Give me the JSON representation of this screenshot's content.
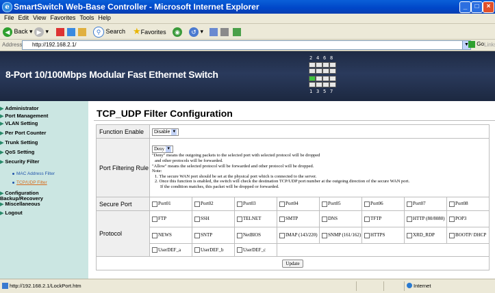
{
  "window": {
    "title": "SmartSwitch Web-Base Controller - Microsoft Internet Explorer"
  },
  "menu": [
    "File",
    "Edit",
    "View",
    "Favorites",
    "Tools",
    "Help"
  ],
  "toolbar": {
    "back": "Back",
    "search": "Search",
    "favorites": "Favorites"
  },
  "address": {
    "label": "Address",
    "url": "http://192.168.2.1/",
    "go": "Go",
    "links": "Links"
  },
  "banner": {
    "title": "8-Port 10/100Mbps Modular Fast Ethernet Switch",
    "ports_top": [
      "2",
      "4",
      "6",
      "8"
    ],
    "ports_bottom": [
      "1",
      "3",
      "5",
      "7"
    ]
  },
  "sidebar": {
    "items": [
      {
        "label": "Administrator"
      },
      {
        "label": "Port Management"
      },
      {
        "label": "VLAN Setting"
      },
      {
        "label": "Per Port Counter"
      },
      {
        "label": "Trunk Setting"
      },
      {
        "label": "QoS Setting"
      },
      {
        "label": "Security Filter"
      },
      {
        "label": "Configuration Backup/Recovery"
      },
      {
        "label": "Miscellaneous"
      },
      {
        "label": "Logout"
      }
    ],
    "subitems": [
      {
        "label": "MAC Address Filter"
      },
      {
        "label": "TCP/UDP Filter"
      }
    ]
  },
  "page": {
    "title": "TCP_UDP Filter Configuration"
  },
  "form": {
    "function_label": "Function Enable",
    "function_value": "Disable",
    "filter_label": "Port Filtering Rule",
    "filter_value": "Deny",
    "notes": [
      "\"Deny\" means the outgoing packets to the selected port with selected protocol will be dropped",
      "and other protocols will be forwarded.",
      "\"Allow\" means the selected protocol will be forwarded and other protocol will be dropped.",
      "Note:",
      "1. The secure WAN port should be set at the physical port which is connected to the server.",
      "2. Once this function is enabled, the switch will check the destination TCP/UDP port number at the outgoing direction of the secure WAN port.",
      "If the condition matches, this packet will be dropped or forwarded."
    ],
    "secure_label": "Secure Port",
    "ports": [
      "Port01",
      "Port02",
      "Port03",
      "Port04",
      "Port05",
      "Port06",
      "Port07",
      "Port08"
    ],
    "protocol_label": "Protocol",
    "protocols_row1": [
      "FTP",
      "SSH",
      "TELNET",
      "SMTP",
      "DNS",
      "TFTP",
      "HTTP (80/8080)",
      "POP3"
    ],
    "protocols_row2": [
      "NEWS",
      "SNTP",
      "NetBIOS",
      "IMAP (143/220)",
      "SNMP (161/162)",
      "HTTPS",
      "XRD_RDP",
      "BOOTP/ DHCP"
    ],
    "protocols_row3": [
      "UserDEF_a",
      "UserDEF_b",
      "UserDEF_c"
    ],
    "update_label": "Update"
  },
  "status": {
    "url": "http://192.168.2.1/LockPort.htm",
    "zone": "Internet"
  }
}
